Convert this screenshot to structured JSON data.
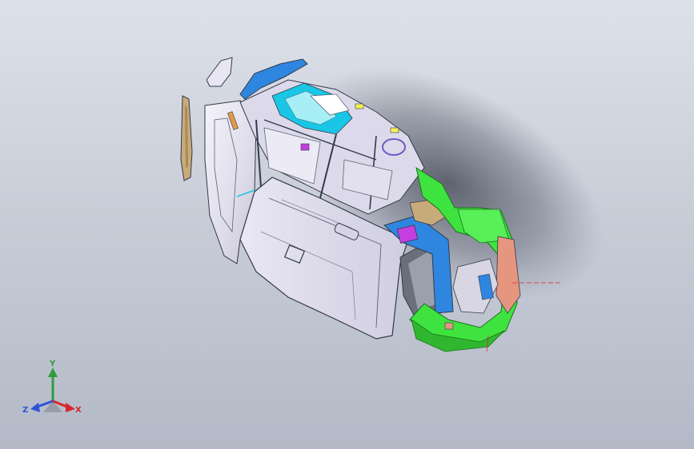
{
  "viewport": {
    "background_top": "#dde1ea",
    "background_bottom": "#b3b9c6"
  },
  "triad": {
    "x_label": "X",
    "y_label": "Y",
    "z_label": "Z",
    "x_color": "#d8262f",
    "y_color": "#2e9d3a",
    "z_color": "#2e54d6"
  },
  "model": {
    "body_color": "#e8e6f2",
    "edge_color": "#333a4a",
    "accent_blue": "#2f86e0",
    "accent_cyan": "#19c6e6",
    "accent_green": "#3fe33f",
    "accent_salmon": "#e6957f",
    "accent_tan": "#c8ab7a",
    "accent_magenta": "#c43fe0",
    "accent_yellow": "#f6ef58"
  }
}
